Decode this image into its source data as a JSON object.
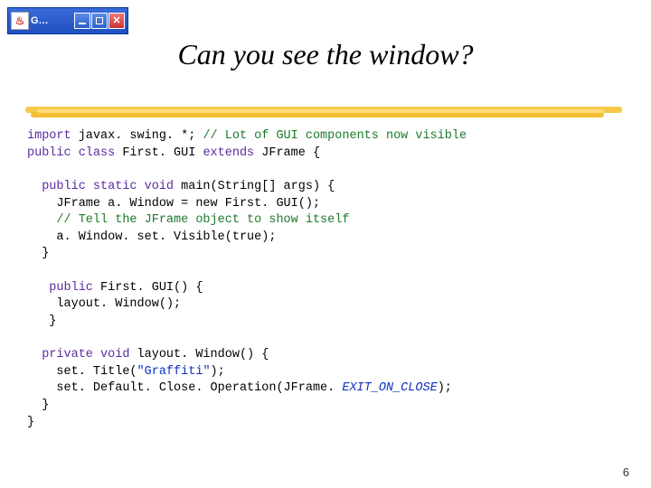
{
  "window": {
    "title": "G…"
  },
  "slide": {
    "title": "Can you see the window?",
    "page_number": "6"
  },
  "code": {
    "l1a": "import",
    "l1b": " javax. swing. *; ",
    "l1c": "// Lot of GUI components now visible",
    "l2a": "public class",
    "l2b": " First. GUI ",
    "l2c": "extends",
    "l2d": " JFrame {",
    "l3": "",
    "l4a": "  public static void",
    "l4b": " main(String[] args) {",
    "l5": "    JFrame a. Window = new First. GUI();",
    "l6": "    // Tell the JFrame object to show itself",
    "l7": "    a. Window. set. Visible(true);",
    "l8": "  }",
    "l9": "",
    "l10a": "   public",
    "l10b": " First. GUI() {",
    "l11": "    layout. Window();",
    "l12": "   }",
    "l13": "",
    "l14a": "  private void",
    "l14b": " layout. Window() {",
    "l15a": "    set. Title(",
    "l15b": "\"Graffiti\"",
    "l15c": ");",
    "l16a": "    set. Default. Close. Operation(JFrame. ",
    "l16b": "EXIT_ON_CLOSE",
    "l16c": ");",
    "l17": "  }",
    "l18": "}"
  }
}
